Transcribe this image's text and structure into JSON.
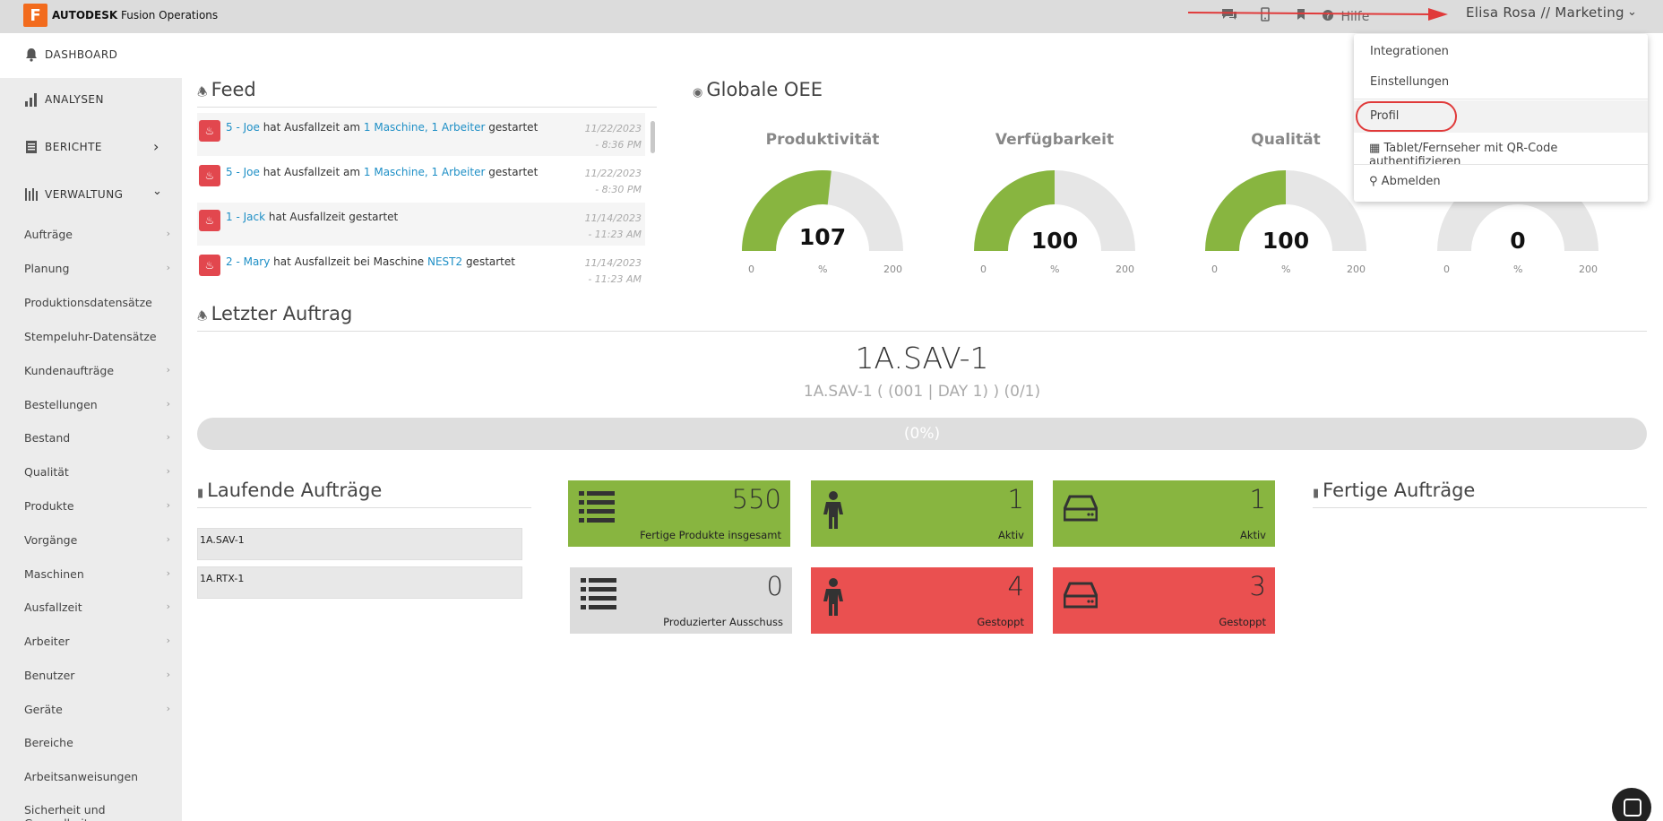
{
  "app": {
    "logo_letter": "F",
    "brand": "AUTODESK",
    "product": "Fusion Operations"
  },
  "topbar": {
    "help_label": "Hilfe",
    "user_label": "Elisa Rosa // Marketing"
  },
  "sidebar": {
    "dashboard": "DASHBOARD",
    "analysen": "ANALYSEN",
    "berichte": "BERICHTE",
    "verwaltung": "VERWALTUNG",
    "items": [
      "Aufträge",
      "Planung",
      "Produktionsdatensätze",
      "Stempeluhr-Datensätze",
      "Kundenaufträge",
      "Bestellungen",
      "Bestand",
      "Qualität",
      "Produkte",
      "Vorgänge",
      "Maschinen",
      "Ausfallzeit",
      "Arbeiter",
      "Benutzer",
      "Geräte",
      "Bereiche",
      "Arbeitsanweisungen",
      "Sicherheit und Gesundheit"
    ]
  },
  "feed": {
    "title": "Feed",
    "items": [
      {
        "who": "5 - Joe",
        "t1": "hat Ausfallzeit am",
        "target": "1 Maschine, 1 Arbeiter",
        "t2": "gestartet",
        "date": "11/22/2023",
        "time": "- 8:36 PM"
      },
      {
        "who": "5 - Joe",
        "t1": "hat Ausfallzeit am",
        "target": "1 Maschine, 1 Arbeiter",
        "t2": "gestartet",
        "date": "11/22/2023",
        "time": "- 8:30 PM"
      },
      {
        "who": "1 - Jack",
        "t1": "hat Ausfallzeit gestartet",
        "target": "",
        "t2": "",
        "date": "11/14/2023",
        "time": "- 11:23 AM"
      },
      {
        "who": "2 - Mary",
        "t1": "hat Ausfallzeit bei Maschine",
        "target": "NEST2",
        "t2": "gestartet",
        "date": "11/14/2023",
        "time": "- 11:23 AM"
      }
    ]
  },
  "oee": {
    "title": "Globale OEE",
    "gauges": [
      {
        "title": "Produktivität",
        "value": "107",
        "numeric": 107,
        "min": "0",
        "unit": "%",
        "max": "200"
      },
      {
        "title": "Verfügbarkeit",
        "value": "100",
        "numeric": 100,
        "min": "0",
        "unit": "%",
        "max": "200"
      },
      {
        "title": "Qualität",
        "value": "100",
        "numeric": 100,
        "min": "0",
        "unit": "%",
        "max": "200"
      },
      {
        "title": "",
        "value": "0",
        "numeric": 0,
        "min": "0",
        "unit": "%",
        "max": "200"
      }
    ]
  },
  "menu": {
    "items": [
      "Integrationen",
      "Einstellungen",
      "Profil",
      "Tablet/Fernseher mit QR-Code authentifizieren",
      "Abmelden"
    ]
  },
  "last_order": {
    "title": "Letzter Auftrag",
    "name": "1A.SAV-1",
    "detail": "1A.SAV-1 ( (001 | DAY 1) ) (0/1)",
    "progress_label": "(0%)",
    "progress": 0
  },
  "running": {
    "title": "Laufende Aufträge",
    "items": [
      "1A.SAV-1",
      "1A.RTX-1"
    ]
  },
  "finished": {
    "title": "Fertige Aufträge"
  },
  "tiles": [
    {
      "value": "550",
      "label": "Fertige Produkte insgesamt",
      "color": "#88b540",
      "icon": "list-icon"
    },
    {
      "value": "1",
      "label": "Aktiv",
      "color": "#88b540",
      "icon": "worker-icon"
    },
    {
      "value": "1",
      "label": "Aktiv",
      "color": "#88b540",
      "icon": "machine-icon"
    },
    {
      "value": "0",
      "label": "Produzierter Ausschuss",
      "color": "#dcdcdc",
      "icon": "list-icon"
    },
    {
      "value": "4",
      "label": "Gestoppt",
      "color": "#ea5050",
      "icon": "worker-icon"
    },
    {
      "value": "3",
      "label": "Gestoppt",
      "color": "#ea5050",
      "icon": "machine-icon"
    }
  ]
}
